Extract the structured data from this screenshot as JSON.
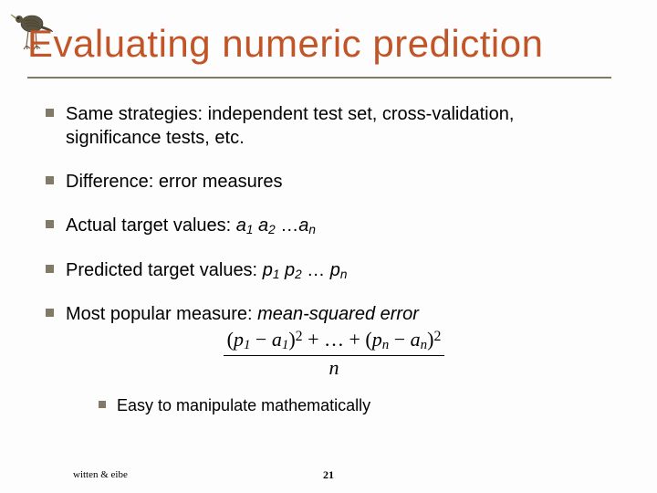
{
  "title": "Evaluating numeric prediction",
  "bullets": {
    "b0": "Same strategies: independent test set, cross-validation, significance tests, etc.",
    "b1": "Difference: error measures",
    "b2_pre": "Actual target values: ",
    "b2_seq": {
      "a": "a",
      "s1": "1",
      "s2": "2",
      "sn": "n",
      "ell": " …"
    },
    "b3_pre": "Predicted target values: ",
    "b3_seq": {
      "p": "p",
      "s1": "1",
      "s2": "2",
      "sn": "n",
      "ell": " … "
    },
    "b4_pre": "Most popular measure: ",
    "b4_emph": "mean-squared error",
    "sub": "Easy to manipulate mathematically"
  },
  "formula": {
    "lp": "(",
    "p": "p",
    "m": " − ",
    "a": "a",
    "rp": ")",
    "sq": "2",
    "plus": " + … + ",
    "s1": "1",
    "sn": "n",
    "den": "n"
  },
  "footer": {
    "left": "witten & eibe",
    "center": "21"
  }
}
